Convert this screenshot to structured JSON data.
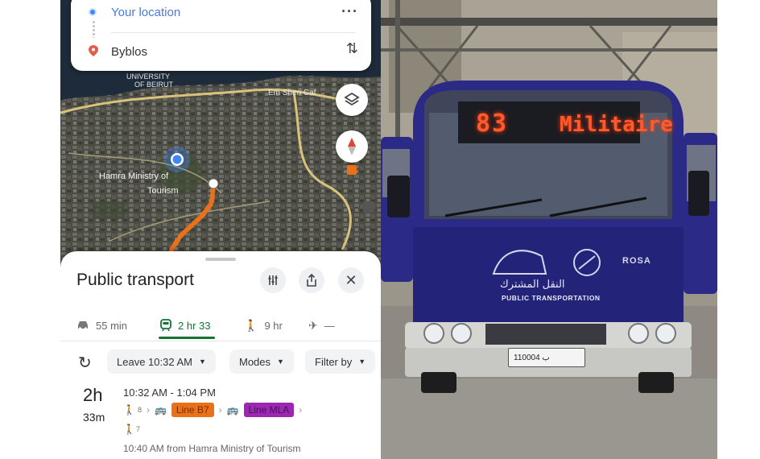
{
  "route": {
    "origin": "Your location",
    "destination": "Byblos",
    "more_icon": "more-horiz-icon",
    "swap_icon": "swap-vert-icon"
  },
  "map": {
    "labels": {
      "university": "UNIVERSITY",
      "beirut": "OF BEIRUT",
      "sheraton": "Em Sheri Caf",
      "hamra": "Hamra Ministry of",
      "tourism": "Tourism"
    },
    "route_color": "#e8711a",
    "road_color": "#d9c27a",
    "buttons": [
      "layers-icon",
      "compass-icon"
    ]
  },
  "sheet": {
    "title": "Public transport",
    "actions": [
      "filter-icon",
      "share-icon",
      "close-icon"
    ],
    "modes": [
      {
        "name": "car",
        "label": "55 min"
      },
      {
        "name": "transit",
        "label": "2 hr 33"
      },
      {
        "name": "walk",
        "label": "9 hr"
      },
      {
        "name": "flight",
        "label": "—"
      }
    ],
    "active_mode": "transit",
    "active_color": "#137333",
    "options": {
      "leave": "Leave 10:32 AM",
      "modes": "Modes",
      "filter": "Filter by"
    },
    "trip": {
      "duration_hours": "2h",
      "duration_minutes": "33m",
      "time_range": "10:32 AM - 1:04 PM",
      "walk1": "8",
      "line1": "Line B7",
      "line2": "Line MLA",
      "walk2": "7",
      "depart": "10:40 AM from Hamra Ministry of Tourism"
    }
  },
  "bus": {
    "route_number": "83",
    "destination_sign": "Militaire",
    "arabic_text": "النقل المشترك",
    "livery_text": "PUBLIC TRANSPORTATION",
    "brand": "ROSA",
    "plate": "ب 110004",
    "body_color": "#2b2a86"
  }
}
